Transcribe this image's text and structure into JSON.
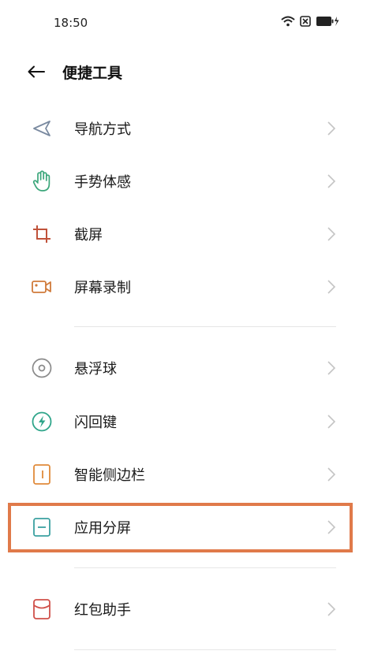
{
  "status_bar": {
    "time": "18:50"
  },
  "header": {
    "title": "便捷工具"
  },
  "items": [
    {
      "label": "导航方式",
      "icon": "navigation-arrow-icon"
    },
    {
      "label": "手势体感",
      "icon": "hand-gesture-icon"
    },
    {
      "label": "截屏",
      "icon": "crop-icon"
    },
    {
      "label": "屏幕录制",
      "icon": "video-camera-icon"
    },
    {
      "label": "悬浮球",
      "icon": "floating-ball-icon"
    },
    {
      "label": "闪回键",
      "icon": "flash-back-icon"
    },
    {
      "label": "智能侧边栏",
      "icon": "sidebar-icon"
    },
    {
      "label": "应用分屏",
      "icon": "split-screen-icon"
    },
    {
      "label": "红包助手",
      "icon": "red-envelope-icon"
    }
  ],
  "colors": {
    "nav": "#7a8aa0",
    "gesture": "#3aa67a",
    "crop": "#c0523a",
    "record": "#d07a3a",
    "float": "#8a8a8a",
    "flash": "#2fa58a",
    "sidebar": "#e08a3a",
    "split": "#3aa0a0",
    "redpacket": "#d0504a",
    "highlight": "#e07a4a"
  }
}
